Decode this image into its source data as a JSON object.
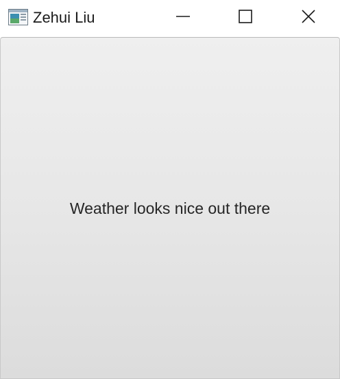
{
  "window": {
    "title": "Zehui Liu",
    "icon": "app-window-icon",
    "controls": {
      "minimize_icon": "minimize-icon",
      "maximize_icon": "maximize-icon",
      "close_icon": "close-icon"
    }
  },
  "content": {
    "message": "Weather looks nice out there"
  },
  "colors": {
    "content_gradient_top": "#efefef",
    "content_gradient_bottom": "#dcdcdc",
    "text": "#262626"
  }
}
